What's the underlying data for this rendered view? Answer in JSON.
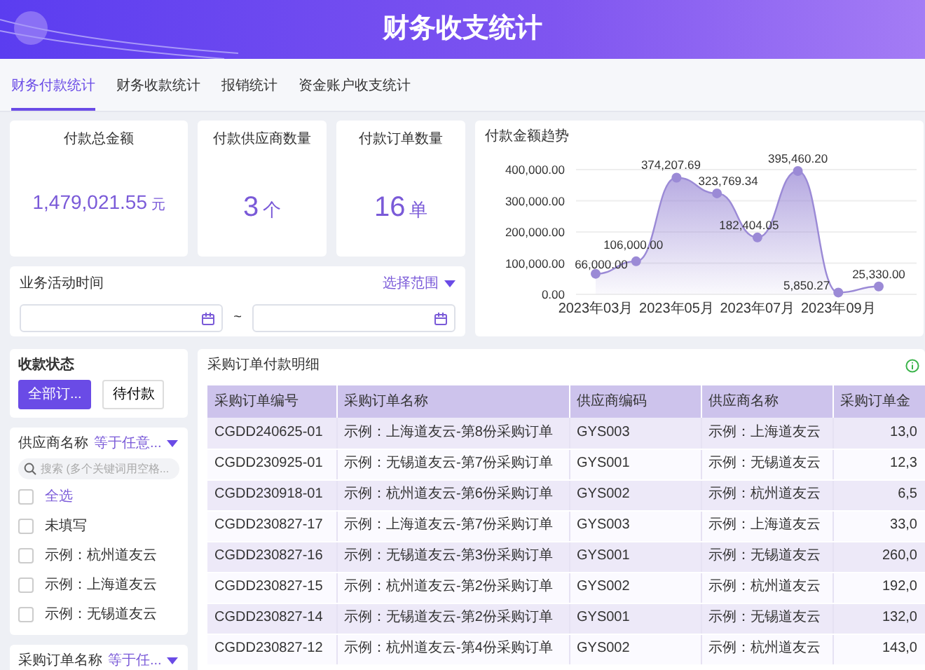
{
  "header": {
    "title": "财务收支统计"
  },
  "tabs": [
    {
      "label": "财务付款统计",
      "selected": true
    },
    {
      "label": "财务收款统计",
      "selected": false
    },
    {
      "label": "报销统计",
      "selected": false
    },
    {
      "label": "资金账户收支统计",
      "selected": false
    }
  ],
  "stats": [
    {
      "label": "付款总金额",
      "value": "1,479,021.55",
      "unit": "元"
    },
    {
      "label": "付款供应商数量",
      "value": "3",
      "unit": "个"
    },
    {
      "label": "付款订单数量",
      "value": "16",
      "unit": "单"
    }
  ],
  "date_filter": {
    "label": "业务活动时间",
    "range_button": "选择范围",
    "separator": "~"
  },
  "trend": {
    "title": "付款金额趋势",
    "chart_data": {
      "type": "area",
      "categories": [
        "2023年03月",
        null,
        "2023年05月",
        null,
        "2023年07月",
        null,
        "2023年09月",
        null
      ],
      "series": [
        {
          "color": "#9b8ad6",
          "values": [
            66000,
            106000,
            374207.69,
            323769.34,
            182404.05,
            395460.2,
            5850.27,
            25330
          ]
        }
      ],
      "yticks": [
        {
          "value": 0,
          "label": "0.00"
        },
        {
          "value": 100000,
          "label": "100,000.00"
        },
        {
          "value": 200000,
          "label": "200,000.00"
        },
        {
          "value": 300000,
          "label": "300,000.00"
        },
        {
          "value": 400000,
          "label": "400,000.00"
        }
      ],
      "ylim": [
        0,
        400000
      ],
      "grid": true,
      "value_labels": [
        "66,000.00",
        "106,000.00",
        "374,207.69",
        "323,769.34",
        "182,404.05",
        "395,460.20",
        "5,850.27",
        "25,330.00"
      ]
    }
  },
  "status_filter": {
    "title": "收款状态",
    "options": [
      {
        "label": "全部订...",
        "selected": true
      },
      {
        "label": "待付款",
        "selected": false
      }
    ]
  },
  "supplier_filter": {
    "title": "供应商名称",
    "operator": "等于任意...",
    "search_placeholder": "搜索 (多个关键词用空格...",
    "options": [
      {
        "label": "全选",
        "kind": "all",
        "checked": false
      },
      {
        "label": "未填写",
        "kind": "item",
        "checked": false
      },
      {
        "label": "示例：杭州道友云",
        "kind": "item",
        "checked": false
      },
      {
        "label": "示例：上海道友云",
        "kind": "item",
        "checked": false
      },
      {
        "label": "示例：无锡道友云",
        "kind": "item",
        "checked": false
      }
    ]
  },
  "order_filter": {
    "title": "采购订单名称",
    "operator": "等于任..."
  },
  "table": {
    "title": "采购订单付款明细",
    "columns": [
      "采购订单编号",
      "采购订单名称",
      "供应商编码",
      "供应商名称",
      "采购订单金"
    ],
    "rows": [
      [
        "CGDD240625-01",
        "示例：上海道友云-第8份采购订单",
        "GYS003",
        "示例：上海道友云",
        "13,0"
      ],
      [
        "CGDD230925-01",
        "示例：无锡道友云-第7份采购订单",
        "GYS001",
        "示例：无锡道友云",
        "12,3"
      ],
      [
        "CGDD230918-01",
        "示例：杭州道友云-第6份采购订单",
        "GYS002",
        "示例：杭州道友云",
        "6,5"
      ],
      [
        "CGDD230827-17",
        "示例：上海道友云-第7份采购订单",
        "GYS003",
        "示例：上海道友云",
        "33,0"
      ],
      [
        "CGDD230827-16",
        "示例：无锡道友云-第3份采购订单",
        "GYS001",
        "示例：无锡道友云",
        "260,0"
      ],
      [
        "CGDD230827-15",
        "示例：杭州道友云-第2份采购订单",
        "GYS002",
        "示例：杭州道友云",
        "192,0"
      ],
      [
        "CGDD230827-14",
        "示例：无锡道友云-第2份采购订单",
        "GYS001",
        "示例：无锡道友云",
        "132,0"
      ],
      [
        "CGDD230827-12",
        "示例：杭州道友云-第4份采购订单",
        "GYS002",
        "示例：杭州道友云",
        "143,0"
      ]
    ]
  }
}
